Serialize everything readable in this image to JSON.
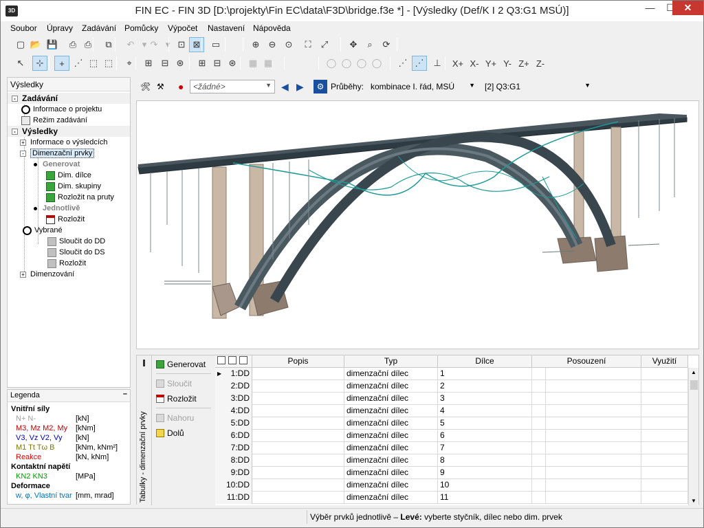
{
  "window": {
    "title": "FIN EC - FIN 3D [D:\\projekty\\Fin EC\\data\\F3D\\bridge.f3e *] - [Výsledky (Def/K I 2 Q3:G1 MSÚ)]",
    "icon_label": "3D",
    "min_glyph": "—",
    "max_glyph": "☐",
    "close_glyph": "✕"
  },
  "menu": [
    "Soubor",
    "Úpravy",
    "Zadávání",
    "Pomůcky",
    "Výpočet",
    "Nastavení",
    "Nápověda"
  ],
  "toolbar1": [
    {
      "name": "new-file-icon",
      "glyph": "▢"
    },
    {
      "name": "open-folder-icon",
      "glyph": "📂"
    },
    {
      "name": "save-icon",
      "glyph": "💾"
    },
    {
      "name": "print-icon",
      "glyph": "⎙"
    },
    {
      "name": "print-preview-icon",
      "glyph": "⎙"
    },
    {
      "name": "copy-icon",
      "glyph": "⧉"
    },
    {
      "name": "undo-icon",
      "glyph": "↶"
    },
    {
      "name": "undo-dropdown-icon",
      "glyph": "▾"
    },
    {
      "name": "redo-icon",
      "glyph": "↷"
    },
    {
      "name": "redo-dropdown-icon",
      "glyph": "▾"
    },
    {
      "name": "input-mode-icon",
      "glyph": "⊡"
    },
    {
      "name": "results-mode-icon",
      "glyph": "⊠"
    },
    {
      "name": "display-icon",
      "glyph": "▭"
    },
    {
      "name": "zoom-in-icon",
      "glyph": "⊕"
    },
    {
      "name": "zoom-out-icon",
      "glyph": "⊖"
    },
    {
      "name": "zoom-window-icon",
      "glyph": "⊙"
    },
    {
      "name": "zoom-extents-icon",
      "glyph": "⛶"
    },
    {
      "name": "zoom-fit-icon",
      "glyph": "⤢"
    },
    {
      "name": "pan-icon",
      "glyph": "✥"
    },
    {
      "name": "zoom-realtime-icon",
      "glyph": "⌕"
    },
    {
      "name": "rotate-icon",
      "glyph": "⟳"
    }
  ],
  "toolbar2": [
    {
      "name": "select-pointer-icon",
      "glyph": "↖"
    },
    {
      "name": "select-member-icon",
      "glyph": "⊹"
    },
    {
      "name": "add-node-icon",
      "glyph": "+"
    },
    {
      "name": "add-member-icon",
      "glyph": "⋰"
    },
    {
      "name": "add-rect-icon",
      "glyph": "⬚"
    },
    {
      "name": "add-polygon-icon",
      "glyph": "⬚"
    },
    {
      "name": "snap-icon",
      "glyph": "⌖"
    },
    {
      "name": "add-square-icon",
      "glyph": "⊞"
    },
    {
      "name": "remove-square-icon",
      "glyph": "⊟"
    },
    {
      "name": "star-square-icon",
      "glyph": "⊛"
    },
    {
      "name": "plus-square-icon",
      "glyph": "⊞"
    },
    {
      "name": "minus-square-icon",
      "glyph": "⊟"
    },
    {
      "name": "star-square-2-icon",
      "glyph": "⊛"
    },
    {
      "name": "grid-icon",
      "glyph": "▦"
    },
    {
      "name": "grid-2-icon",
      "glyph": "▦"
    },
    {
      "name": "bulb-icon",
      "glyph": "◯"
    },
    {
      "name": "bulb-add-icon",
      "glyph": "◯"
    },
    {
      "name": "bulb-star-icon",
      "glyph": "◯"
    },
    {
      "name": "bulb-minus-icon",
      "glyph": "◯"
    },
    {
      "name": "view-perspective-icon",
      "glyph": "⋰"
    },
    {
      "name": "view-render-icon",
      "glyph": "⋰"
    },
    {
      "name": "axes-icon",
      "glyph": "⊥"
    },
    {
      "name": "view-x-plus-icon",
      "glyph": "X+"
    },
    {
      "name": "view-x-minus-icon",
      "glyph": "X-"
    },
    {
      "name": "view-y-plus-icon",
      "glyph": "Y+"
    },
    {
      "name": "view-y-minus-icon",
      "glyph": "Y-"
    },
    {
      "name": "view-z-plus-icon",
      "glyph": "Z+"
    },
    {
      "name": "view-z-minus-icon",
      "glyph": "Z-"
    }
  ],
  "left_panel": {
    "header": "Výsledky",
    "tree": [
      {
        "label": "Zadávání",
        "kind": "group",
        "expander": "-"
      },
      {
        "label": "Informace o projektu",
        "kind": "circle"
      },
      {
        "label": "Režim zadávání",
        "kind": "icon"
      },
      {
        "label": "Výsledky",
        "kind": "group",
        "expander": "-"
      },
      {
        "label": "Informace o výsledcích",
        "kind": "expand",
        "expander": "+"
      },
      {
        "label": "Dimenzační prvky",
        "kind": "expand-selected",
        "expander": "-"
      },
      {
        "label": "Generovat",
        "kind": "dot-bold"
      },
      {
        "label": "Dim. dílce",
        "kind": "green"
      },
      {
        "label": "Dim. skupiny",
        "kind": "green"
      },
      {
        "label": "Rozložit na pruty",
        "kind": "green"
      },
      {
        "label": "Jednotlivě",
        "kind": "dot-bold"
      },
      {
        "label": "Rozložit",
        "kind": "red"
      },
      {
        "label": "Vybrané",
        "kind": "circle"
      },
      {
        "label": "Sloučit do DD",
        "kind": "grey"
      },
      {
        "label": "Sloučit do DS",
        "kind": "grey"
      },
      {
        "label": "Rozložit",
        "kind": "grey"
      },
      {
        "label": "Dimenzování",
        "kind": "expand",
        "expander": "+"
      }
    ]
  },
  "legend": {
    "header": "Legenda",
    "collapse_glyph": "–",
    "rows": [
      {
        "text": "Vnitřní síly",
        "bold": true,
        "unit": ""
      },
      {
        "text": "N+ N-",
        "color": "#a0a0a0",
        "unit": "[kN]"
      },
      {
        "text": "M3, Mz M2, My",
        "color": "#c00000",
        "unit": "[kNm]"
      },
      {
        "text": "V3, Vz V2, Vy",
        "color": "#0000c0",
        "unit": "[kN]"
      },
      {
        "text": "M1 Tt Tω B",
        "color": "#7a7a00",
        "unit": "[kNm, kNm²]"
      },
      {
        "text": "Reakce",
        "color": "#e00000",
        "unit": "[kN, kNm]"
      },
      {
        "text": "Kontaktní napětí",
        "bold": true,
        "unit": ""
      },
      {
        "text": "KN2 KN3",
        "color": "#00a000",
        "unit": "[MPa]"
      },
      {
        "text": "Deformace",
        "bold": true,
        "unit": ""
      },
      {
        "text": "w, φ, Vlastní tvar",
        "color": "#0070c0",
        "unit": "[mm, mrad]"
      }
    ]
  },
  "view_toolbar": {
    "combo_case": "<žádné>",
    "label_prubehy": "Průběhy:",
    "combo_combination": "kombinace I. řád, MSÚ",
    "combo_case2": "[2] Q3:G1"
  },
  "bottom": {
    "vertical_title": "Tabulky - dimenzační prvky",
    "actions": [
      {
        "label": "Generovat",
        "enabled": true,
        "icon": "green"
      },
      {
        "label": "Sloučit",
        "enabled": false,
        "icon": "grey"
      },
      {
        "label": "Rozložit",
        "enabled": true,
        "icon": "red"
      },
      {
        "label": "Nahoru",
        "enabled": false,
        "icon": "grey"
      },
      {
        "label": "Dolů",
        "enabled": true,
        "icon": "yellow"
      }
    ],
    "columns": [
      "Popis",
      "Typ",
      "Dílce",
      "Posouzení",
      "Využití"
    ],
    "rows": [
      {
        "id": "1:DD",
        "popis": "",
        "typ": "dimenzační dílec",
        "dilce": "1",
        "current": true
      },
      {
        "id": "2:DD",
        "popis": "",
        "typ": "dimenzační dílec",
        "dilce": "2"
      },
      {
        "id": "3:DD",
        "popis": "",
        "typ": "dimenzační dílec",
        "dilce": "3"
      },
      {
        "id": "4:DD",
        "popis": "",
        "typ": "dimenzační dílec",
        "dilce": "4"
      },
      {
        "id": "5:DD",
        "popis": "",
        "typ": "dimenzační dílec",
        "dilce": "5"
      },
      {
        "id": "6:DD",
        "popis": "",
        "typ": "dimenzační dílec",
        "dilce": "6"
      },
      {
        "id": "7:DD",
        "popis": "",
        "typ": "dimenzační dílec",
        "dilce": "7"
      },
      {
        "id": "8:DD",
        "popis": "",
        "typ": "dimenzační dílec",
        "dilce": "8"
      },
      {
        "id": "9:DD",
        "popis": "",
        "typ": "dimenzační dílec",
        "dilce": "9"
      },
      {
        "id": "10:DD",
        "popis": "",
        "typ": "dimenzační dílec",
        "dilce": "10"
      },
      {
        "id": "11:DD",
        "popis": "",
        "typ": "dimenzační dílec",
        "dilce": "11"
      }
    ]
  },
  "status": {
    "prefix": "Výběr prvků jednotlivě – ",
    "bold": "Levé:",
    "suffix": " vyberte styčník, dílec nebo dim. prvek"
  },
  "colors": {
    "deck": "#3d4a52",
    "arch": "#5b6a72",
    "pylon": "#c9b8a6",
    "cables": "#1f9a9a"
  }
}
